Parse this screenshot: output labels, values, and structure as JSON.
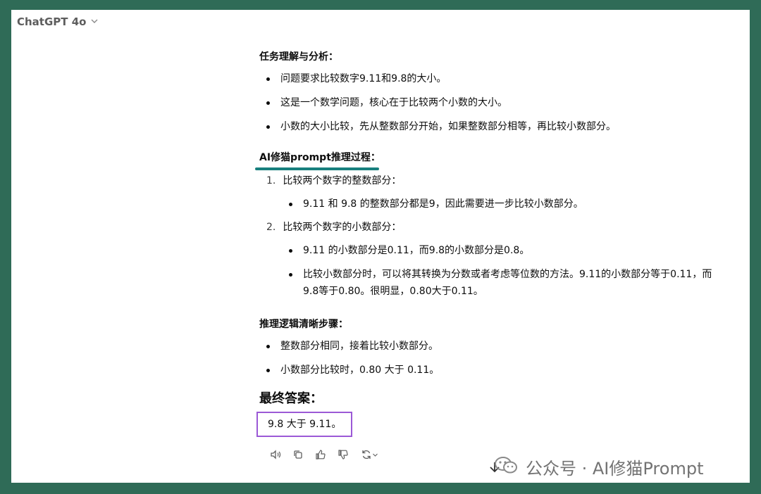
{
  "header": {
    "model_name": "ChatGPT 4o"
  },
  "response": {
    "section1": {
      "title": "任务理解与分析：",
      "bullets": [
        "问题要求比较数字9.11和9.8的大小。",
        "这是一个数学问题，核心在于比较两个小数的大小。",
        "小数的大小比较，先从整数部分开始，如果整数部分相等，再比较小数部分。"
      ]
    },
    "section2": {
      "title": "AI修猫prompt推理过程：",
      "steps": [
        {
          "number": "1.",
          "label": "比较两个数字的整数部分：",
          "bullets": [
            "9.11 和 9.8 的整数部分都是9，因此需要进一步比较小数部分。"
          ]
        },
        {
          "number": "2.",
          "label": "比较两个数字的小数部分：",
          "bullets": [
            "9.11 的小数部分是0.11，而9.8的小数部分是0.8。",
            "比较小数部分时，可以将其转换为分数或者考虑等位数的方法。9.11的小数部分等于0.11，而9.8等于0.80。很明显，0.80大于0.11。"
          ]
        }
      ]
    },
    "section3": {
      "title": "推理逻辑清晰步骤：",
      "bullets": [
        "整数部分相同，接着比较小数部分。",
        "小数部分比较时，0.80 大于 0.11。"
      ]
    },
    "final": {
      "title": "最终答案：",
      "answer": "9.8 大于 9.11。"
    }
  },
  "actions": [
    "speaker-icon",
    "copy-icon",
    "thumbs-up-icon",
    "thumbs-down-icon",
    "regenerate-icon"
  ],
  "watermark": {
    "text": "公众号 · AI修猫Prompt"
  },
  "colors": {
    "background": "#2f6b57",
    "underline": "#18807e",
    "answer_border": "#9b59d6"
  }
}
